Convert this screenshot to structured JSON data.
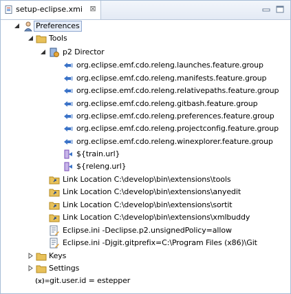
{
  "tab": {
    "label": "setup-eclipse.xmi",
    "close_glyph": "⊠"
  },
  "tree": {
    "root": "Preferences",
    "tools": "Tools",
    "director": "p2 Director",
    "features": [
      "org.eclipse.emf.cdo.releng.launches.feature.group",
      "org.eclipse.emf.cdo.releng.manifests.feature.group",
      "org.eclipse.emf.cdo.releng.relativepaths.feature.group",
      "org.eclipse.emf.cdo.releng.gitbash.feature.group",
      "org.eclipse.emf.cdo.releng.preferences.feature.group",
      "org.eclipse.emf.cdo.releng.projectconfig.feature.group",
      "org.eclipse.emf.cdo.releng.winexplorer.feature.group"
    ],
    "repos": [
      "${train.url}",
      "${releng.url}"
    ],
    "links": [
      "Link Location C:\\develop\\bin\\extensions\\tools",
      "Link Location C:\\develop\\bin\\extensions\\anyedit",
      "Link Location C:\\develop\\bin\\extensions\\sortit",
      "Link Location C:\\develop\\bin\\extensions\\xmlbuddy"
    ],
    "ini": [
      "Eclipse.ini -Declipse.p2.unsignedPolicy=allow",
      "Eclipse.ini -Djgit.gitprefix=C:\\Program Files (x86)\\Git"
    ],
    "keys": "Keys",
    "settings": "Settings",
    "variable": "git.user.id = estepper",
    "variable_glyph": "(x)="
  },
  "colors": {
    "folder": "#e8c15a",
    "selection": "#e7eef9",
    "feature_icon": "#3b73c8",
    "repo_icon": "#7a4fb8"
  },
  "icons": {
    "tab": "xmi-file-icon",
    "root": "preferences-icon",
    "folder": "folder-icon",
    "director": "p2-director-icon",
    "feature": "feature-icon",
    "repo": "repository-icon",
    "link": "link-location-icon",
    "ini": "eclipse-ini-icon",
    "variable": "variable-icon"
  }
}
